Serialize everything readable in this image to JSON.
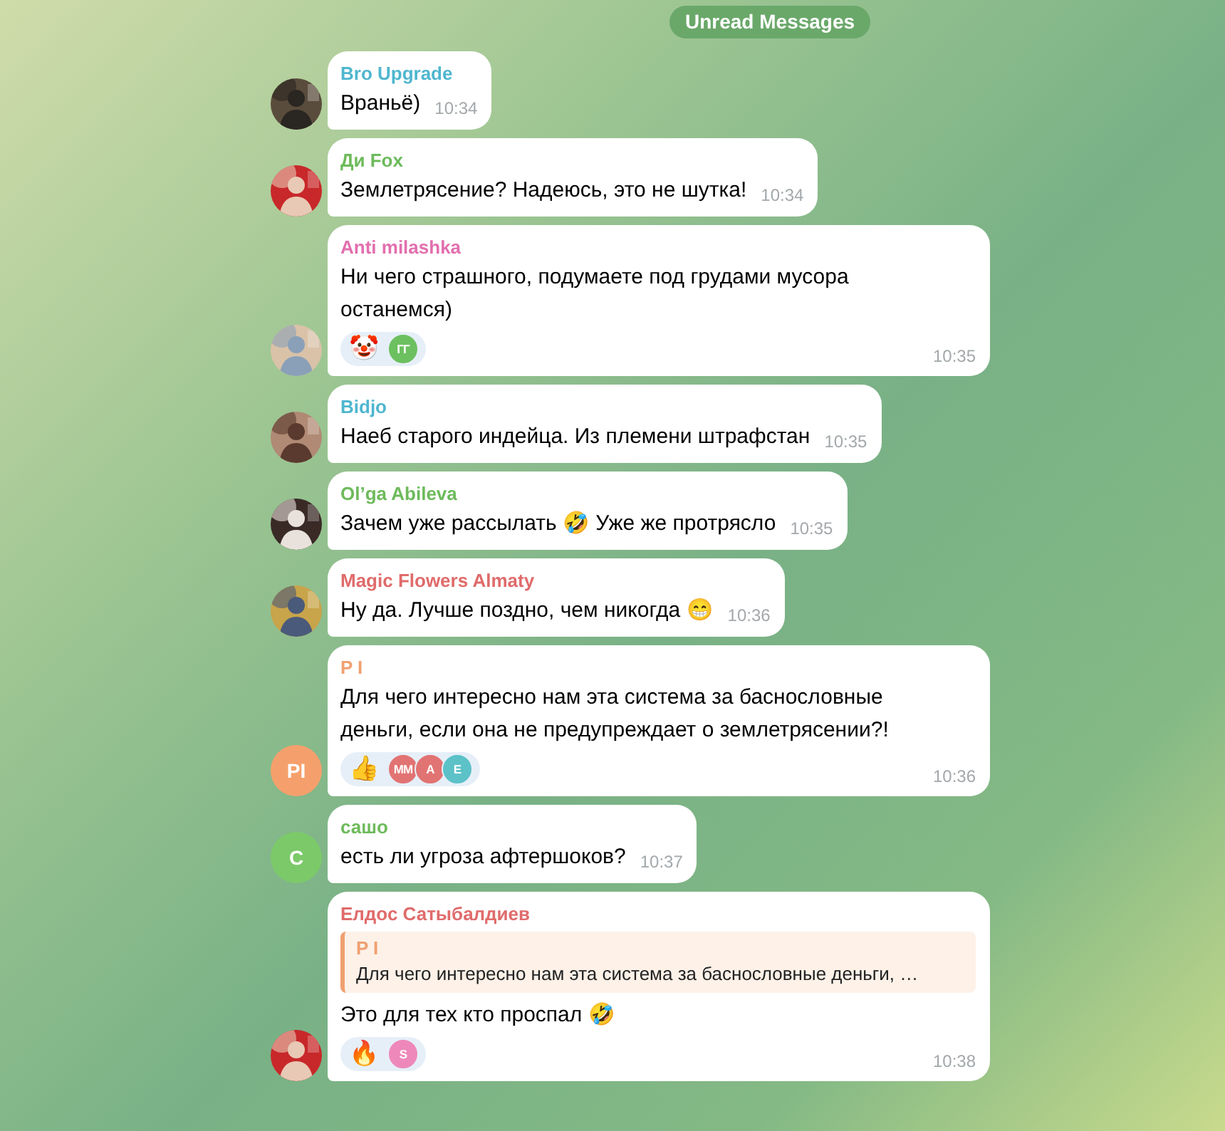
{
  "divider": {
    "label": "Unread Messages"
  },
  "messages": [
    {
      "sender": "Bro Upgrade",
      "color": "#4fb6cf",
      "text": "Враньё)",
      "time": "10:34"
    },
    {
      "sender": "Ди Fox",
      "color": "#6dba5b",
      "text": "Землетрясение? Надеюсь, это не шутка!",
      "time": "10:34"
    },
    {
      "sender": "Anti milashka",
      "color": "#e26fae",
      "text": "Ни чего страшного, подумаете под грудами мусора останемся)",
      "time": "10:35",
      "reactions": [
        {
          "emoji": "🤡",
          "users": [
            {
              "initials": "ГГ",
              "color": "#6cc05f"
            }
          ]
        }
      ]
    },
    {
      "sender": "Bidjo",
      "color": "#4fb6cf",
      "text": "Наеб старого индейца. Из племени штрафстан",
      "time": "10:35"
    },
    {
      "sender": "Ol’ga Abileva",
      "color": "#6dba5b",
      "text": "Зачем уже рассылать 🤣 Уже же протрясло",
      "time": "10:35"
    },
    {
      "sender": "Magic Flowers Almaty",
      "color": "#e06b6b",
      "text": "Ну да. Лучше поздно, чем никогда 😁",
      "time": "10:36"
    },
    {
      "sender": "P I",
      "color": "#f0a070",
      "avatar": {
        "kind": "initials",
        "text": "PI",
        "color": "#f5a06c"
      },
      "text": "Для чего интересно нам эта система за баснословные деньги, если она не предупреждает о землетрясении?!",
      "time": "10:36",
      "reactions": [
        {
          "emoji": "👍",
          "users": [
            {
              "initials": "ММ",
              "color": "#e27373"
            },
            {
              "initials": "А",
              "color": "#e27373"
            },
            {
              "initials": "Е",
              "color": "#5cc2c8"
            }
          ]
        }
      ]
    },
    {
      "sender": "сашо",
      "color": "#6dba5b",
      "avatar": {
        "kind": "initials",
        "text": "C",
        "color": "#7cc96a"
      },
      "text": "есть ли угроза афтершоков?",
      "time": "10:37"
    },
    {
      "sender": "Елдос Сатыбалдиев",
      "color": "#e06b6b",
      "reply": {
        "sender": "P I",
        "color": "#f0a070",
        "text": "Для чего интересно нам эта система за баснословные деньги, …"
      },
      "text": "Это для тех кто проспал 🤣",
      "time": "10:38",
      "reactions": [
        {
          "emoji": "🔥",
          "users": [
            {
              "initials": "S",
              "color": "#ee88bb"
            }
          ]
        }
      ]
    }
  ]
}
